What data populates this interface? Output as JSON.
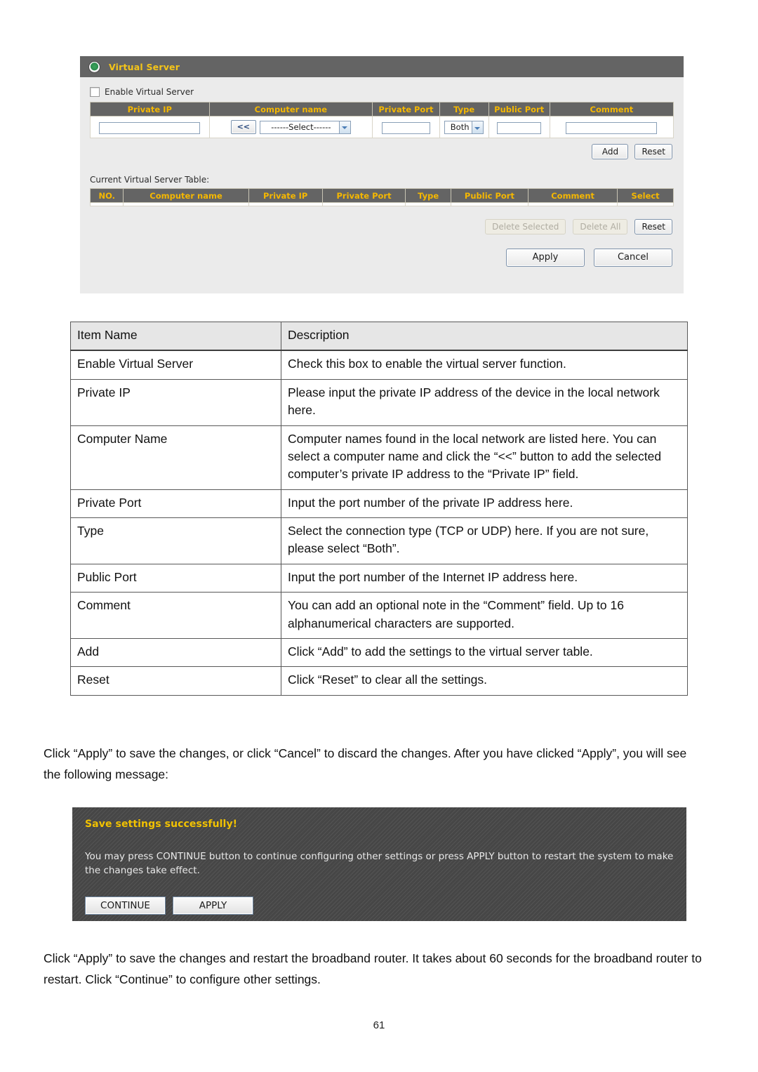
{
  "router_panel": {
    "title": "Virtual Server",
    "bullet_icon": "green-radio-icon",
    "enable_checkbox_label": "Enable Virtual Server",
    "form_headers": [
      "Private IP",
      "Computer name",
      "Private Port",
      "Type",
      "Public Port",
      "Comment"
    ],
    "fields": {
      "private_ip_value": "",
      "copy_button_label": "<<",
      "computer_name_selected": "------Select------",
      "private_port_value": "",
      "type_selected": "Both",
      "public_port_value": "",
      "comment_value": ""
    },
    "add_label": "Add",
    "reset_label": "Reset",
    "current_table_caption": "Current Virtual Server Table:",
    "current_table_headers": [
      "NO.",
      "Computer name",
      "Private IP",
      "Private Port",
      "Type",
      "Public Port",
      "Comment",
      "Select"
    ],
    "current_table_rows": [],
    "delete_selected_label": "Delete Selected",
    "delete_all_label": "Delete All",
    "reset2_label": "Reset",
    "apply_label": "Apply",
    "cancel_label": "Cancel",
    "colors": {
      "header_bar": "#646464",
      "header_text": "#f5c518",
      "panel_bg": "#ebebeb",
      "table_header_text": "#f5b700"
    }
  },
  "description_table": {
    "headers": [
      "Item Name",
      "Description"
    ],
    "rows": [
      {
        "item": "Enable Virtual Server",
        "desc": "Check this box to enable the virtual server function."
      },
      {
        "item": "Private IP",
        "desc": "Please input the private IP address of the device in the local network here."
      },
      {
        "item": "Computer Name",
        "desc": "Computer names found in the local network are listed here. You can select a computer name and click the “<<” button to add the selected computer’s private IP address to the “Private IP” field."
      },
      {
        "item": "Private Port",
        "desc": "Input the port number of the private IP address here."
      },
      {
        "item": "Type",
        "desc": "Select the connection type (TCP or UDP) here. If you are not sure, please select “Both”."
      },
      {
        "item": "Public Port",
        "desc": "Input the port number of the Internet IP address here."
      },
      {
        "item": "Comment",
        "desc": "You can add an optional note in the “Comment” field. Up to 16 alphanumerical characters are supported."
      },
      {
        "item": "Add",
        "desc": "Click “Add” to add the settings to the virtual server table."
      },
      {
        "item": "Reset",
        "desc": "Click “Reset” to clear all the settings."
      }
    ]
  },
  "paragraphs": {
    "apply_intro": "Click “Apply” to save the changes, or click “Cancel” to discard the changes. After you have clicked “Apply”, you will see the following message:",
    "restart_note": "Click “Apply” to save the changes and restart the broadband router. It takes about 60 seconds for the broadband router to restart. Click “Continue” to configure other settings."
  },
  "save_panel": {
    "title": "Save settings successfully!",
    "message": "You may press CONTINUE button to continue configuring other settings or press APPLY button to restart the system to make the changes take effect.",
    "continue_label": "CONTINUE",
    "apply_label": "APPLY",
    "title_color": "#f2c200",
    "background": "#4a4a4a"
  },
  "page_number": "61"
}
